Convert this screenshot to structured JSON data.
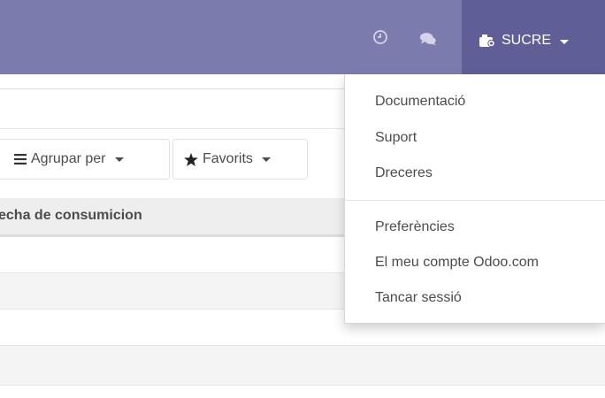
{
  "navbar": {
    "user_name": "SUCRE",
    "colors": {
      "bar": "#7c7bad",
      "active": "#5f5e97"
    }
  },
  "toolbar": {
    "group_by_label": "Agrupar per",
    "favorites_label": "Favorits"
  },
  "table": {
    "column_header": "echa de consumicion",
    "rows": 4
  },
  "user_dropdown": {
    "items": [
      "Documentació",
      "Suport",
      "Dreceres"
    ],
    "items2": [
      "Preferències",
      "El meu compte Odoo.com",
      "Tancar sessió"
    ]
  }
}
